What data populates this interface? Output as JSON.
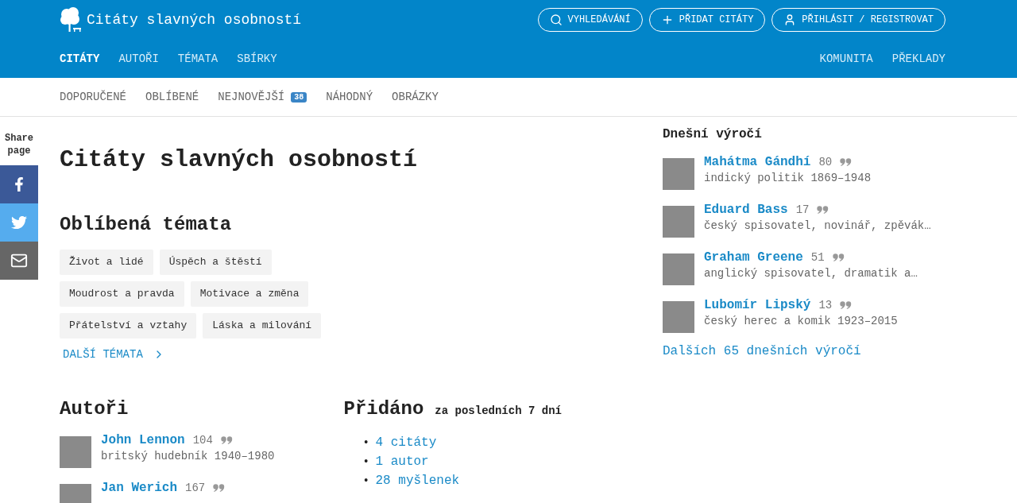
{
  "header": {
    "site_title": "Citáty slavných osobností",
    "actions": [
      {
        "kind": "search",
        "label": "VYHLEDÁVÁNÍ"
      },
      {
        "kind": "add",
        "label": "PŘIDAT CITÁTY"
      },
      {
        "kind": "user",
        "label": "PŘIHLÁSIT / REGISTROVAT"
      }
    ],
    "primary_nav": [
      {
        "label": "CITÁTY",
        "selected": true
      },
      {
        "label": "AUTOŘI",
        "selected": false
      },
      {
        "label": "TÉMATA",
        "selected": false
      },
      {
        "label": "SBÍRKY",
        "selected": false
      }
    ],
    "secondary_nav": [
      {
        "label": "KOMUNITA",
        "selected": false
      },
      {
        "label": "PŘEKLADY",
        "selected": false
      }
    ]
  },
  "subnav": [
    {
      "label": "DOPORUČENÉ"
    },
    {
      "label": "OBLÍBENÉ"
    },
    {
      "label": "NEJNOVĚJŠÍ",
      "badge": "38"
    },
    {
      "label": "NÁHODNÝ"
    },
    {
      "label": "OBRÁZKY"
    }
  ],
  "share": {
    "label": "Share page",
    "buttons": [
      {
        "kind": "facebook"
      },
      {
        "kind": "twitter"
      },
      {
        "kind": "email"
      }
    ]
  },
  "main": {
    "title": "Citáty slavných osobností",
    "topics": {
      "title": "Oblíbená témata",
      "tags": [
        "Život a lidé",
        "Úspěch a štěstí",
        "Moudrost a pravda",
        "Motivace a změna",
        "Přátelství a vztahy",
        "Láska a milování"
      ],
      "more": "DALŠÍ TÉMATA"
    },
    "authors": {
      "title": "Autoři",
      "items": [
        {
          "name": "John Lennon",
          "count": "104",
          "description": "britský hudebník 1940–1980"
        },
        {
          "name": "Jan Werich",
          "count": "167"
        }
      ]
    },
    "added": {
      "title": "Přidáno",
      "subtitle": "za posledních 7 dní",
      "items": [
        {
          "marker": "•",
          "label": "4 citáty"
        },
        {
          "marker": "•",
          "label": "1 autor"
        },
        {
          "marker": "•",
          "label": "28 myšlenek"
        }
      ]
    }
  },
  "sidebar": {
    "title": "Dnešní výročí",
    "items": [
      {
        "name": "Mahátma Gándhí",
        "count": "80",
        "description": "indický politik 1869–1948"
      },
      {
        "name": "Eduard Bass",
        "count": "17",
        "description": "český spisovatel, novinář, zpěvák…"
      },
      {
        "name": "Graham Greene",
        "count": "51",
        "description": "anglický spisovatel, dramatik a…"
      },
      {
        "name": "Lubomír Lipský",
        "count": "13",
        "description": "český herec a komik 1923–2015"
      }
    ],
    "more": "Dalších 65 dnešních výročí"
  }
}
